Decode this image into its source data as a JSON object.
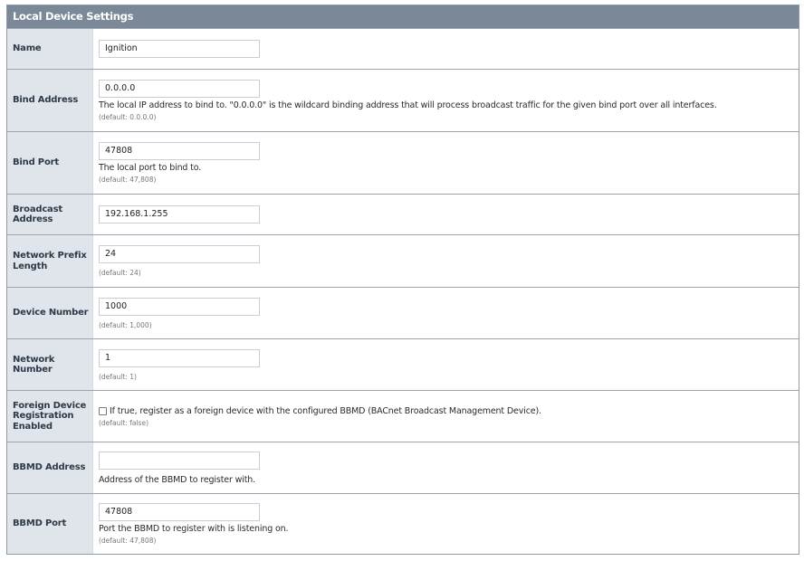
{
  "panel": {
    "title": "Local Device Settings"
  },
  "fields": {
    "name": {
      "label": "Name",
      "value": "Ignition"
    },
    "bind_address": {
      "label": "Bind Address",
      "value": "0.0.0.0",
      "description": "The local IP address to bind to. \"0.0.0.0\" is the wildcard binding address that will process broadcast traffic for the given bind port over all interfaces.",
      "default": "(default: 0.0.0.0)"
    },
    "bind_port": {
      "label": "Bind Port",
      "value": "47808",
      "description": "The local port to bind to.",
      "default": "(default: 47,808)"
    },
    "broadcast_address": {
      "label": "Broadcast Address",
      "value": "192.168.1.255"
    },
    "network_prefix_length": {
      "label": "Network Prefix Length",
      "value": "24",
      "default": "(default: 24)"
    },
    "device_number": {
      "label": "Device Number",
      "value": "1000",
      "default": "(default: 1,000)"
    },
    "network_number": {
      "label": "Network Number",
      "value": "1",
      "default": "(default: 1)"
    },
    "foreign_device_registration": {
      "label": "Foreign Device Registration Enabled",
      "checked": false,
      "description": "If true, register as a foreign device with the configured BBMD (BACnet Broadcast Management Device).",
      "default": "(default: false)"
    },
    "bbmd_address": {
      "label": "BBMD Address",
      "value": "",
      "description": "Address of the BBMD to register with."
    },
    "bbmd_port": {
      "label": "BBMD Port",
      "value": "47808",
      "description": "Port the BBMD to register with is listening on.",
      "default": "(default: 47,808)"
    }
  }
}
